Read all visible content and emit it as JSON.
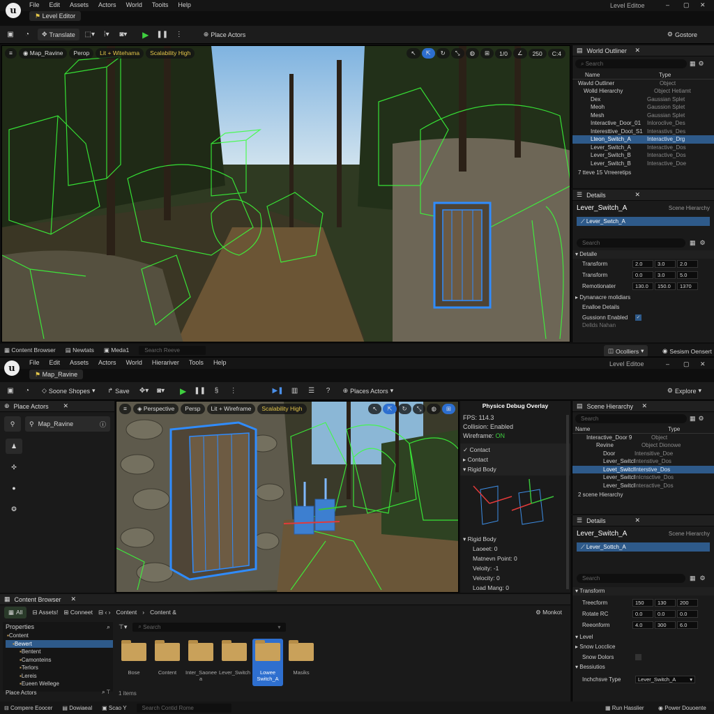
{
  "top": {
    "menu": [
      "File",
      "Edit",
      "Assets",
      "Actors",
      "World",
      "Tooits",
      "Help"
    ],
    "tab": "Level Editor",
    "window_title": "Level Editoe",
    "toolbar": {
      "translate": "Translate",
      "place_actors": "Place Actors",
      "right": "Gostore"
    },
    "viewport": {
      "map": "Map_Ravine",
      "perspective": "Perop",
      "lit_wireframe": "Lit + Witehama",
      "scalability": "Scalability High",
      "stats": [
        "1/0",
        "250",
        "C:4"
      ]
    },
    "outliner": {
      "title": "World Outliner",
      "search": "Search",
      "col_name": "Name",
      "col_type": "Type",
      "rows": [
        {
          "name": "Wavld Outliner",
          "type": "Object"
        },
        {
          "name": "Wolld Hierarchy",
          "type": "Object Hetiamt"
        },
        {
          "name": "Dex",
          "type": "Gaussian Splet"
        },
        {
          "name": "Meoh",
          "type": "Gaussion Splet"
        },
        {
          "name": "Mesh",
          "type": "Gaussian Splet"
        },
        {
          "name": "Interactive_Door_01",
          "type": "Inloroclive_Des"
        },
        {
          "name": "Interesttive_Doot_S1",
          "type": "Interastivs_Des"
        },
        {
          "name": "Lteon_Switch_A",
          "type": "Interactive_Drg"
        },
        {
          "name": "Lever_Switch_A",
          "type": "Interactive_Dos"
        },
        {
          "name": "Lever_Switch_B",
          "type": "Interactive_Dos"
        },
        {
          "name": "Lever_Switch_B",
          "type": "Interactive_Doe"
        }
      ],
      "footer": "7 tteve 15 Vrreeretips"
    },
    "details": {
      "title": "Details",
      "actor": "Lever_Switch_A",
      "scene": "Scene Hierarchy",
      "selected": "Lever_Swtch_A",
      "search": "Search",
      "section": "Detalle",
      "props": [
        {
          "label": "Transform",
          "v": [
            "2.0",
            "3.0",
            "2.0"
          ]
        },
        {
          "label": "Transform",
          "v": [
            "0.0",
            "3.0",
            "5.0"
          ]
        },
        {
          "label": "Remotionater",
          "v": [
            "130.0",
            "150.0",
            "1370"
          ]
        }
      ],
      "more": [
        "Dynanacre molidiars",
        "Enalloe Details",
        "Gussionn Enabled",
        "Dellds Nahan"
      ]
    },
    "statusbar": {
      "left": [
        "Content Browser",
        "Newtats",
        "Meda1"
      ],
      "search": "Search Reeve",
      "right": [
        "Ocolliers",
        "Sesism Oensert"
      ]
    }
  },
  "bottom": {
    "menu": [
      "File",
      "Edit",
      "Assets",
      "Actors",
      "World",
      "Hierariver",
      "Tools",
      "Help"
    ],
    "tab": "Map_Ravine",
    "window_title": "Level Editoe",
    "toolbar": {
      "scene_shapes": "Soone Shopes",
      "save": "Save",
      "place_actors": "Places Actors",
      "right": "Explore"
    },
    "place_actors": {
      "title": "Place Actors",
      "item": "Map_Ravine",
      "footer": "Place Actors"
    },
    "viewport": {
      "perspective": "Perspective",
      "persp": "Persp",
      "lit_wireframe": "Lit + Wireframe",
      "scalability": "Scalability High"
    },
    "physics": {
      "title": "Physice Debug Overlay",
      "fps": "FPS: 114.3",
      "collision": "Collision: Enabled",
      "wireframe_label": "Wireframe:",
      "wireframe_value": "ON",
      "items": [
        "Contact",
        "Contact",
        "Rigid Body"
      ],
      "rigid_title": "Rigid Body",
      "rigid": [
        "Laoeet: 0",
        "Matnevn Point: 0",
        "Veloity: -1",
        "Velocity: 0",
        "Load Mang: 0"
      ]
    },
    "hierarchy": {
      "title": "Scene Hierarchy",
      "search": "Search",
      "col_name": "Name",
      "col_type": "Type",
      "rows": [
        {
          "name": "Interactive_Door 9",
          "type": "Object"
        },
        {
          "name": "Revine",
          "type": "Object Dionowe"
        },
        {
          "name": "Door",
          "type": "Intensitive_Doe"
        },
        {
          "name": "Lever_Switch_A",
          "type": "Intenstive_Dos"
        },
        {
          "name": "Lovet_Switch_A",
          "type": "Interstive_Dos"
        },
        {
          "name": "Lever_Switch_B",
          "type": "Inlcnsctive_Dos"
        },
        {
          "name": "Lever_Switch_B",
          "type": "Interactive_Dos"
        }
      ],
      "footer": "2 scene Hierarchy"
    },
    "details": {
      "title": "Details",
      "actor": "Lever_Switch_A",
      "scene": "Scene Hierarchy",
      "selected": "Lever_Sottch_A",
      "search": "Search",
      "section": "Transform",
      "props": [
        {
          "label": "Treecform",
          "v": [
            "150",
            "130",
            "200"
          ]
        },
        {
          "label": "Rotate RC",
          "v": [
            "0.0",
            "0.0",
            "0.0"
          ]
        },
        {
          "label": "Reeonform",
          "v": [
            "4.0",
            "300",
            "6.0"
          ]
        }
      ],
      "level": "Level",
      "show_location": "Snow Locclice",
      "show_colors": "Snow Dolors",
      "sessions": "Bessiutios",
      "interactive_type_label": "Inchchsve Type",
      "interactive_type_value": "Lever_Switch_A"
    },
    "content_browser": {
      "title": "Content Browser",
      "all": "All",
      "assets": "Assets!",
      "connect": "Conneet",
      "path": [
        "Content",
        "Content &"
      ],
      "monitor": "Monkot",
      "properties": "Properties",
      "tree": [
        "Content",
        "Bewert",
        "Bentent",
        "Camonteins",
        "Terlors",
        "Lereis",
        "Eueen Wellege"
      ],
      "search": "Search",
      "assets_list": [
        "Bose",
        "Content",
        "Inter_Saonee a",
        "Lever_Switch",
        "Lowee Switch_A",
        "Masiks"
      ],
      "count": "1 items"
    },
    "statusbar": {
      "items": [
        "Compere Eoocer",
        "Dowiaeal",
        "Scao Y"
      ],
      "search": "Search Contid Rome",
      "right": [
        "Run Hasslier",
        "Power Douoente"
      ]
    }
  }
}
